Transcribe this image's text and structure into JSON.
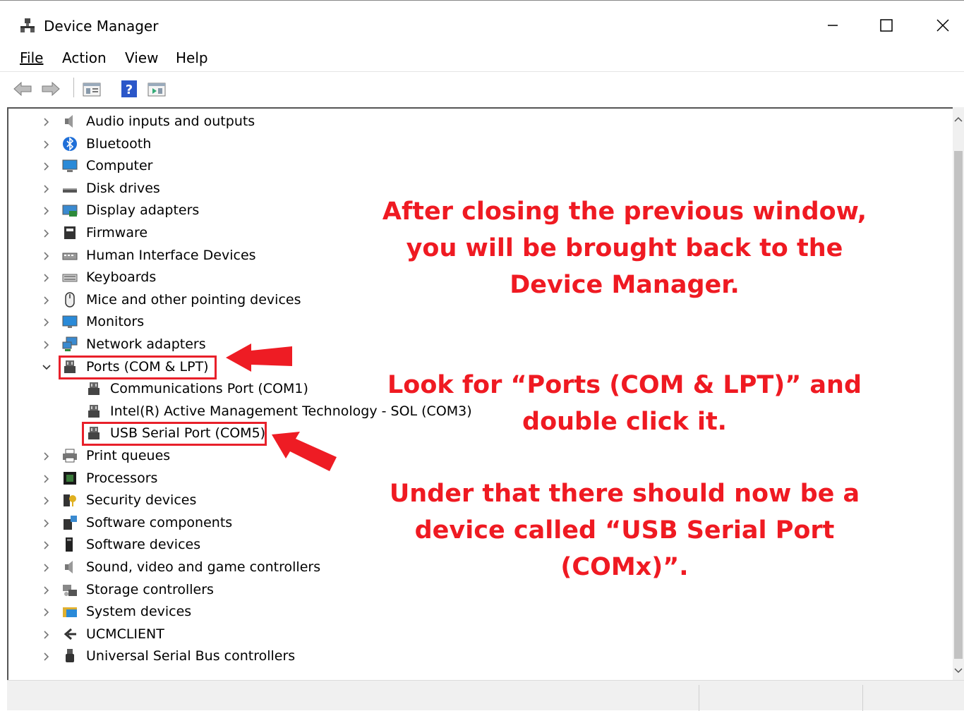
{
  "window": {
    "title": "Device Manager"
  },
  "menu": {
    "file": "File",
    "action": "Action",
    "view": "View",
    "help": "Help"
  },
  "toolbar": {
    "back_icon": "arrow-left-icon",
    "forward_icon": "arrow-right-icon",
    "properties_icon": "properties-icon",
    "help_icon": "help-icon",
    "update_icon": "update-driver-icon"
  },
  "tree": {
    "categories": [
      {
        "label": "Audio inputs and outputs",
        "icon": "speaker-icon"
      },
      {
        "label": "Bluetooth",
        "icon": "bluetooth-icon"
      },
      {
        "label": "Computer",
        "icon": "computer-icon"
      },
      {
        "label": "Disk drives",
        "icon": "disk-drive-icon"
      },
      {
        "label": "Display adapters",
        "icon": "display-adapter-icon"
      },
      {
        "label": "Firmware",
        "icon": "firmware-icon"
      },
      {
        "label": "Human Interface Devices",
        "icon": "hid-icon"
      },
      {
        "label": "Keyboards",
        "icon": "keyboard-icon"
      },
      {
        "label": "Mice and other pointing devices",
        "icon": "mouse-icon"
      },
      {
        "label": "Monitors",
        "icon": "monitor-icon"
      },
      {
        "label": "Network adapters",
        "icon": "network-icon"
      },
      {
        "label": "Ports (COM & LPT)",
        "icon": "port-icon",
        "expanded": true
      },
      {
        "label": "Print queues",
        "icon": "printer-icon"
      },
      {
        "label": "Processors",
        "icon": "processor-icon"
      },
      {
        "label": "Security devices",
        "icon": "security-icon"
      },
      {
        "label": "Software components",
        "icon": "software-component-icon"
      },
      {
        "label": "Software devices",
        "icon": "software-device-icon"
      },
      {
        "label": "Sound, video and game controllers",
        "icon": "speaker-icon"
      },
      {
        "label": "Storage controllers",
        "icon": "storage-icon"
      },
      {
        "label": "System devices",
        "icon": "system-folder-icon"
      },
      {
        "label": "UCMCLIENT",
        "icon": "ucm-icon"
      },
      {
        "label": "Universal Serial Bus controllers",
        "icon": "usb-icon"
      }
    ],
    "ports_children": [
      {
        "label": "Communications Port (COM1)",
        "icon": "port-icon"
      },
      {
        "label": "Intel(R) Active Management Technology - SOL (COM3)",
        "icon": "port-icon"
      },
      {
        "label": "USB Serial Port (COM5)",
        "icon": "port-icon"
      }
    ]
  },
  "annotations": {
    "line1": [
      "After closing the previous window,",
      "you will be brought back to the",
      "Device Manager."
    ],
    "line2": [
      "Look for “Ports (COM & LPT)” and",
      "double click it."
    ],
    "line3": [
      "Under that there should now be a",
      "device called “USB Serial Port",
      "(COMx)”."
    ]
  },
  "colors": {
    "annotation": "#ef1a22",
    "highlight": "#e8202a"
  }
}
